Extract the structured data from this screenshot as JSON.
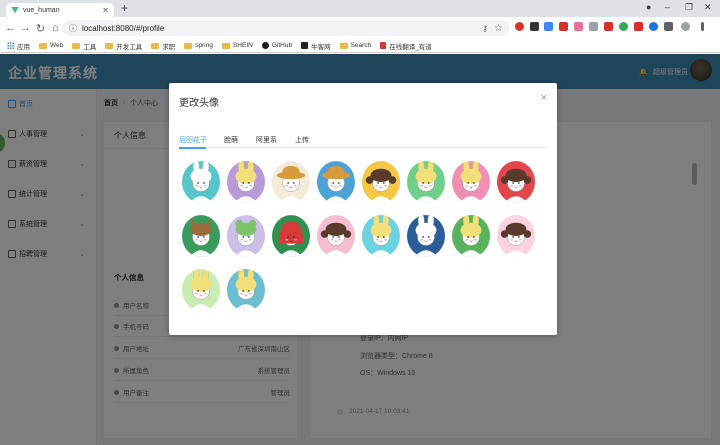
{
  "browser": {
    "tab_title": "vue_human",
    "url": "localhost:8080/#/profile",
    "bookmarks": [
      "应用",
      "Web",
      "工具",
      "开发工具",
      "求职",
      "spring",
      "SHEIN",
      "GitHub",
      "牛客网",
      "Search",
      "在线翻译_有道"
    ]
  },
  "app": {
    "logo": "企业管理系统",
    "user_name": "超级管理员",
    "menu": [
      "首页",
      "人事管理",
      "薪资管理",
      "统计管理",
      "系统管理",
      "招聘管理"
    ],
    "breadcrumb": {
      "home": "首页",
      "current": "个人中心"
    },
    "left_card": {
      "title": "个人信息",
      "subtitle": "个人信息",
      "rows": [
        {
          "label": "用户名称",
          "value": ""
        },
        {
          "label": "手机号码",
          "value": ""
        },
        {
          "label": "用户地址",
          "value": "广东省深圳南山区"
        },
        {
          "label": "所属角色",
          "value": "系统管理员"
        },
        {
          "label": "用户备注",
          "value": "管理员"
        }
      ]
    },
    "right_card": {
      "login_ip": "登录IP：内网IP",
      "login_browser": "浏览器类型：Chrome 8",
      "login_os": "OS：Windows 10",
      "timeline_date": "2021-04-17 10:03:41"
    }
  },
  "dialog": {
    "title": "更改头像",
    "tabs": [
      "后田花子",
      "脸萌",
      "阿里系",
      "上传"
    ],
    "active_tab": 0,
    "avatars": [
      {
        "bg": "#57c6cc",
        "style": "rabbit"
      },
      {
        "bg": "#b89ad6",
        "style": "bunnyhat"
      },
      {
        "bg": "#f3ecd8",
        "style": "hat"
      },
      {
        "bg": "#4da3d8",
        "style": "hat"
      },
      {
        "bg": "#f4c746",
        "style": "pigtails"
      },
      {
        "bg": "#6fcf88",
        "style": "bunnyhat"
      },
      {
        "bg": "#f08fb3",
        "style": "bunnyhat"
      },
      {
        "bg": "#e0464a",
        "style": "pigtails"
      },
      {
        "bg": "#3a9b5d",
        "style": "deer"
      },
      {
        "bg": "#cbbfe8",
        "style": "frog"
      },
      {
        "bg": "#2e9150",
        "style": "redhood"
      },
      {
        "bg": "#f5bdd2",
        "style": "hair"
      },
      {
        "bg": "#6ad3e2",
        "style": "bunnyhat"
      },
      {
        "bg": "#2b5d9b",
        "style": "rabbit"
      },
      {
        "bg": "#59b35c",
        "style": "bunnyhat"
      },
      {
        "bg": "#fbd2e0",
        "style": "pigtails"
      },
      {
        "bg": "#c8ecb4",
        "style": "bunnyhat"
      },
      {
        "bg": "#6cbfd3",
        "style": "bunnyhat"
      }
    ]
  }
}
